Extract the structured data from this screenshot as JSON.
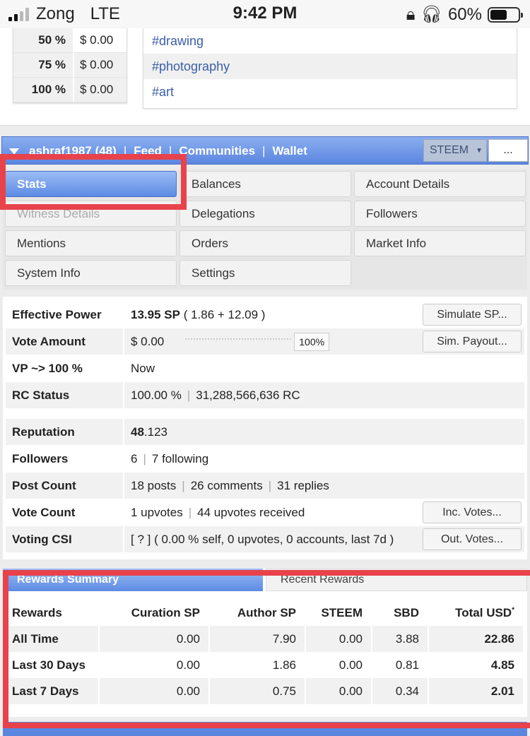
{
  "status_bar": {
    "carrier": "Zong",
    "network": "LTE",
    "time": "9:42 PM",
    "battery": "60%",
    "battery_level": 0.6
  },
  "payout_table": [
    {
      "pct": "50 %",
      "value": "$ 0.00"
    },
    {
      "pct": "75 %",
      "value": "$ 0.00"
    },
    {
      "pct": "100 %",
      "value": "$ 0.00"
    }
  ],
  "tags": [
    "#drawing",
    "#photography",
    "#art"
  ],
  "navbar": {
    "user": "ashraf1987 (48)",
    "feed": "Feed",
    "communities": "Communities",
    "wallet": "Wallet",
    "sep": "|",
    "currency": "STEEM",
    "more": "..."
  },
  "tabs": {
    "stats": "Stats",
    "balances": "Balances",
    "account_details": "Account Details",
    "witness_details": "Witness Details",
    "delegations": "Delegations",
    "followers": "Followers",
    "mentions": "Mentions",
    "orders": "Orders",
    "market_info": "Market Info",
    "system_info": "System Info",
    "settings": "Settings"
  },
  "stats": {
    "effective_power": {
      "label": "Effective Power",
      "value": "13.95 SP",
      "detail": "( 1.86 + 12.09 )",
      "button": "Simulate SP..."
    },
    "vote_amount": {
      "label": "Vote Amount",
      "value": "$ 0.00",
      "slider_pct": "100%",
      "button": "Sim. Payout..."
    },
    "vp": {
      "label": "VP ~> 100 %",
      "value": "Now"
    },
    "rc_status": {
      "label": "RC Status",
      "value": "100.00 %",
      "detail": "31,288,566,636 RC"
    },
    "reputation": {
      "label": "Reputation",
      "value_int": "48",
      "value_dec": ".123"
    },
    "followers": {
      "label": "Followers",
      "value": "6",
      "detail": "7 following"
    },
    "post_count": {
      "label": "Post Count",
      "posts": "18 posts",
      "comments": "26 comments",
      "replies": "31 replies"
    },
    "vote_count": {
      "label": "Vote Count",
      "upvotes": "1 upvotes",
      "received": "44 upvotes received",
      "button": "Inc. Votes..."
    },
    "voting_csi": {
      "label": "Voting CSI",
      "value": "[ ? ] ( 0.00 % self, 0 upvotes, 0 accounts, last 7d )",
      "button": "Out. Votes..."
    }
  },
  "rewards": {
    "tab_summary": "Rewards Summary",
    "tab_recent": "Recent Rewards",
    "headers": [
      "Rewards",
      "Curation SP",
      "Author SP",
      "STEEM",
      "SBD",
      "Total USD"
    ],
    "total_marker": "*",
    "rows": [
      [
        "All Time",
        "0.00",
        "7.90",
        "0.00",
        "3.88",
        "22.86"
      ],
      [
        "Last 30 Days",
        "0.00",
        "1.86",
        "0.00",
        "0.81",
        "4.85"
      ],
      [
        "Last 7 Days",
        "0.00",
        "0.75",
        "0.00",
        "0.34",
        "2.01"
      ]
    ]
  },
  "colors": {
    "accent_blue": "#5b86e0",
    "highlight_red": "#e8424b",
    "tag_link": "#3a5fa8"
  }
}
